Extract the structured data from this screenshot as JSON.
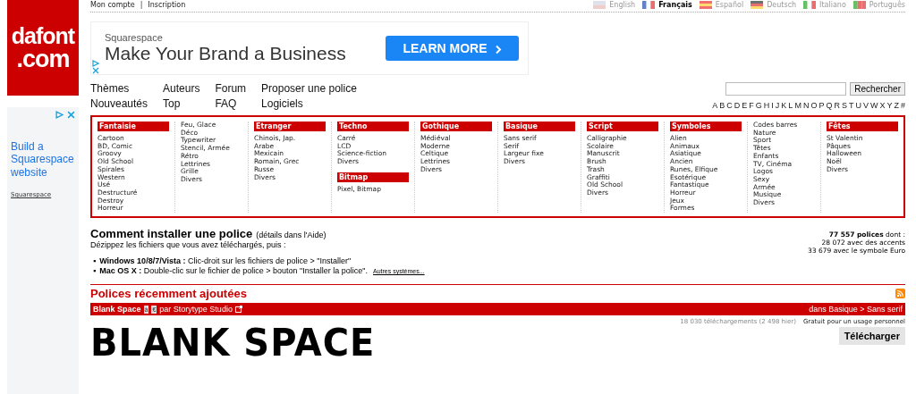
{
  "logo": {
    "line1": "dafont",
    "line2": ".com"
  },
  "side_ad": {
    "headline": "Build a Squarespace website",
    "brand": "Squarespace"
  },
  "account_links": [
    "Mon compte",
    "Inscription"
  ],
  "account_separator": "|",
  "languages": [
    {
      "label": "English",
      "kind": "uk",
      "selected": false
    },
    {
      "label": "Français",
      "kind": "fr",
      "selected": true
    },
    {
      "label": "Español",
      "kind": "es",
      "selected": false
    },
    {
      "label": "Deutsch",
      "kind": "de",
      "selected": false
    },
    {
      "label": "Italiano",
      "kind": "it",
      "selected": false
    },
    {
      "label": "Português",
      "kind": "pt",
      "selected": false
    }
  ],
  "banner_ad": {
    "brand": "Squarespace",
    "headline": "Make Your Brand a Business",
    "button": "LEARN MORE"
  },
  "nav": [
    [
      "Thèmes",
      "Nouveautés"
    ],
    [
      "Auteurs",
      "Top"
    ],
    [
      "Forum",
      "FAQ"
    ],
    [
      "Proposer une police",
      "Logiciels"
    ]
  ],
  "search": {
    "button": "Rechercher"
  },
  "alphabet": [
    "A",
    "B",
    "C",
    "D",
    "E",
    "F",
    "G",
    "H",
    "I",
    "J",
    "K",
    "L",
    "M",
    "N",
    "O",
    "P",
    "Q",
    "R",
    "S",
    "T",
    "U",
    "V",
    "W",
    "X",
    "Y",
    "Z",
    "#"
  ],
  "categories": [
    [
      {
        "heading": "Fantaisie",
        "items": [
          "Cartoon",
          "BD, Comic",
          "Groovy",
          "Old School",
          "Spirales",
          "Western",
          "Usé",
          "Destructuré",
          "Destroy",
          "Horreur"
        ]
      }
    ],
    [
      {
        "items": [
          "Feu, Glace",
          "Déco",
          "Typewriter",
          "Stencil, Armée",
          "Rétro",
          "Lettrines",
          "Grille",
          "Divers"
        ]
      }
    ],
    [
      {
        "heading": "Etranger",
        "items": [
          "Chinois, Jap.",
          "Arabe",
          "Mexicain",
          "Romain, Grec",
          "Russe",
          "Divers"
        ]
      }
    ],
    [
      {
        "heading": "Techno",
        "items": [
          "Carré",
          "LCD",
          "Science-fiction",
          "Divers"
        ]
      },
      {
        "heading": "Bitmap",
        "items": [
          "Pixel, Bitmap"
        ]
      }
    ],
    [
      {
        "heading": "Gothique",
        "items": [
          "Médiéval",
          "Moderne",
          "Celtique",
          "Lettrines",
          "Divers"
        ]
      }
    ],
    [
      {
        "heading": "Basique",
        "items": [
          "Sans serif",
          "Serif",
          "Largeur fixe",
          "Divers"
        ]
      }
    ],
    [
      {
        "heading": "Script",
        "items": [
          "Calligraphie",
          "Scolaire",
          "Manuscrit",
          "Brush",
          "Trash",
          "Graffiti",
          "Old School",
          "Divers"
        ]
      }
    ],
    [
      {
        "heading": "Symboles",
        "items": [
          "Alien",
          "Animaux",
          "Asiatique",
          "Ancien",
          "Runes, Elfique",
          "Esotérique",
          "Fantastique",
          "Horreur",
          "Jeux",
          "Formes"
        ]
      }
    ],
    [
      {
        "items": [
          "Codes barres",
          "Nature",
          "Sport",
          "Têtes",
          "Enfants",
          "TV, Cinéma",
          "Logos",
          "Sexy",
          "Armée",
          "Musique",
          "Divers"
        ]
      }
    ],
    [
      {
        "heading": "Fêtes",
        "items": [
          "St Valentin",
          "Pâques",
          "Halloween",
          "Noël",
          "Divers"
        ]
      }
    ]
  ],
  "install": {
    "title": "Comment installer une police",
    "details": "(détails dans l'Aide)",
    "intro": "Dézippez les fichiers que vous avez téléchargés, puis :",
    "steps": [
      {
        "marker": "▪",
        "text": "**Windows 10/8/7/Vista :** Clic-droit sur les fichiers de police > \"Installer\""
      },
      {
        "marker": "▪",
        "text": "**Mac OS X :** Double-clic sur le fichier de police > bouton \"Installer la police\".",
        "link": "Autres systèmes..."
      }
    ]
  },
  "stats": [
    "**77 557 polices** dont :",
    "28 072 avec des accents",
    "33 679 avec le symbole Euro"
  ],
  "recent": {
    "title": "Polices récemment ajoutées",
    "font": {
      "name": "Blank Space",
      "badges": [
        "à",
        "€"
      ],
      "author": "par Storytype Studio",
      "category": "dans Basique > Sans serif",
      "downloads": "18 030 téléchargements (2 498 hier)",
      "license": "Gratuit pour un usage personnel",
      "preview": "BLANK SPACE",
      "button": "Télécharger"
    }
  }
}
